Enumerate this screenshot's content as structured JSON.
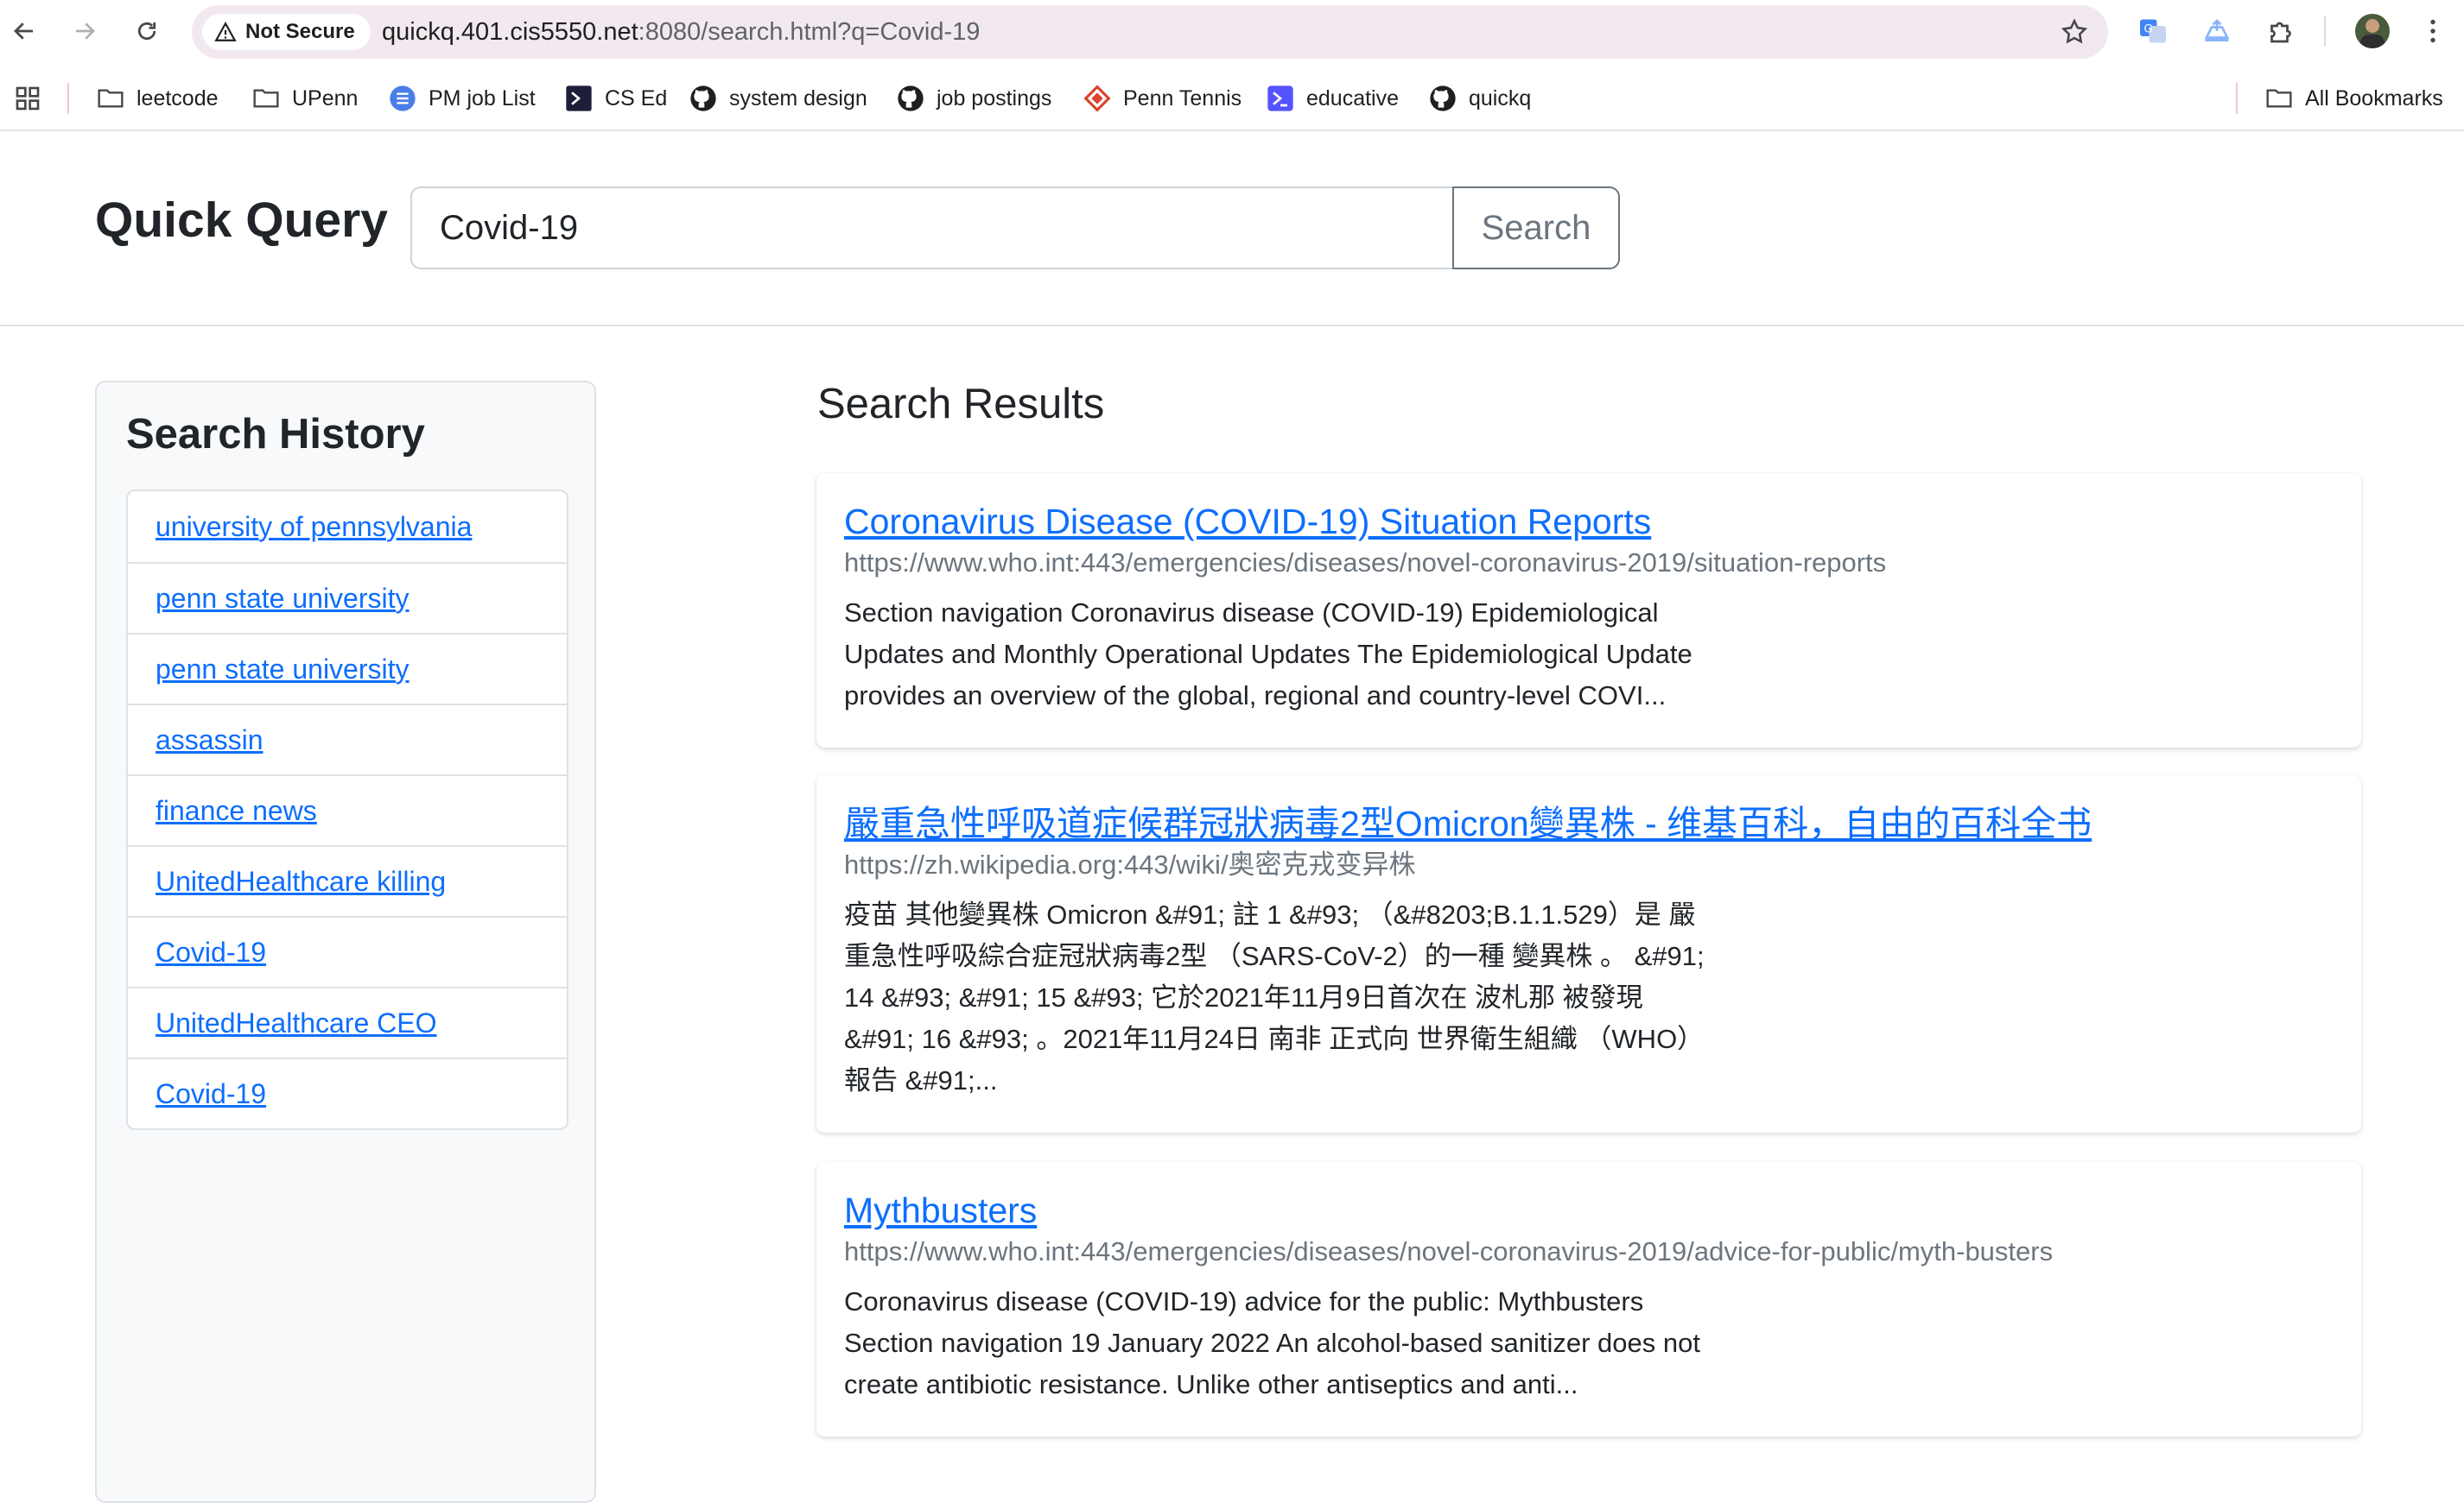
{
  "browser": {
    "security_label": "Not Secure",
    "url_host": "quickq.401.cis5550.net",
    "url_rest": ":8080/search.html?q=Covid-19",
    "extensions": [
      "translate-icon",
      "drive-upload-icon",
      "puzzle-icon"
    ],
    "bookmarks": [
      {
        "label": "leetcode",
        "icon": "folder-icon"
      },
      {
        "label": "UPenn",
        "icon": "folder-icon"
      },
      {
        "label": "PM job List",
        "icon": "list-icon"
      },
      {
        "label": "CS Ed",
        "icon": "terminal-icon"
      },
      {
        "label": "system design",
        "icon": "github-icon"
      },
      {
        "label": "job postings",
        "icon": "github-icon"
      },
      {
        "label": "Penn Tennis",
        "icon": "diamond-icon"
      },
      {
        "label": "educative",
        "icon": "educative-icon"
      },
      {
        "label": "quickq",
        "icon": "github-icon"
      }
    ],
    "all_bookmarks": "All Bookmarks"
  },
  "header": {
    "brand": "Quick Query",
    "search_value": "Covid-19",
    "search_button": "Search"
  },
  "history": {
    "title": "Search History",
    "items": [
      "university of pennsylvania",
      "penn state university",
      "penn state university",
      "assassin",
      "finance news",
      "UnitedHealthcare killing",
      "Covid-19",
      "UnitedHealthcare CEO",
      "Covid-19"
    ]
  },
  "results": {
    "title": "Search Results",
    "items": [
      {
        "title": "Coronavirus Disease (COVID-19) Situation Reports",
        "url": "https://www.who.int:443/emergencies/diseases/novel-coronavirus-2019/situation-reports",
        "snippet": "Section navigation Coronavirus disease (COVID-19) Epidemiological\nUpdates and Monthly Operational Updates The Epidemiological Update\nprovides an overview of the global, regional and country-level COVI..."
      },
      {
        "title": "嚴重急性呼吸道症候群冠狀病毒2型Omicron變異株 - 维基百科，自由的百科全书",
        "url": "https://zh.wikipedia.org:443/wiki/奥密克戎变异株",
        "snippet": "疫苗 其他變異株 Omicron &#91; 註 1 &#93; （&#8203;B.1.1.529）是 嚴\n重急性呼吸綜合症冠狀病毒2型 （SARS-CoV-2）的一種 變異株 。 &#91;\n14 &#93; &#91; 15 &#93; 它於2021年11月9日首次在 波札那 被發現\n&#91; 16 &#93; 。2021年11月24日 南非 正式向 世界衛生組織 （WHO）\n報告 &#91;..."
      },
      {
        "title": "Mythbusters",
        "url": "https://www.who.int:443/emergencies/diseases/novel-coronavirus-2019/advice-for-public/myth-busters",
        "snippet": "Coronavirus disease (COVID-19) advice for the public: Mythbusters\nSection navigation 19 January 2022 An alcohol-based sanitizer does not\ncreate antibiotic resistance. Unlike other antiseptics and anti..."
      }
    ]
  }
}
